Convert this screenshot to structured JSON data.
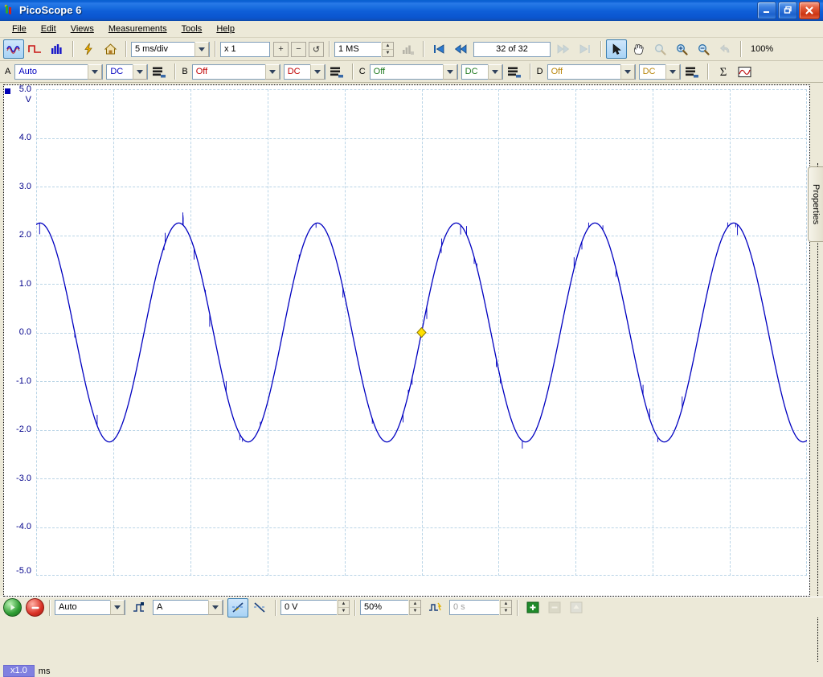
{
  "window": {
    "title": "PicoScope 6",
    "app_icon": "picoscope-logo-icon",
    "minimize_label": "_",
    "restore_label": "❐",
    "close_label": "✕"
  },
  "menubar": {
    "items": [
      {
        "label": "File",
        "accel": "F"
      },
      {
        "label": "Edit",
        "accel": "E"
      },
      {
        "label": "Views",
        "accel": "V"
      },
      {
        "label": "Measurements",
        "accel": "M"
      },
      {
        "label": "Tools",
        "accel": "T"
      },
      {
        "label": "Help",
        "accel": "H"
      }
    ]
  },
  "toolbar": {
    "scope_mode_icon": "sine-wave-icon",
    "spectrum_mode_icon": "square-pulse-icon",
    "bar_mode_icon": "bar-chart-icon",
    "trigger_icon": "lightning-bolt-icon",
    "home_icon": "home-icon",
    "timebase": {
      "value": "5 ms/div",
      "placeholder": "5 ms/div"
    },
    "zoom_factor": {
      "value": "x 1",
      "placeholder": "x 1"
    },
    "zoom_in_label": "+",
    "zoom_out_label": "−",
    "zoom_reset_label": "↺",
    "samples": {
      "value": "1 MS",
      "placeholder": "1 MS"
    },
    "capture_icon": "capture-chart-icon",
    "nav_first_icon": "first-buffer-icon",
    "nav_prev_icon": "previous-buffer-icon",
    "buffer_index": "32 of 32",
    "nav_next_icon": "next-buffer-icon",
    "nav_last_icon": "last-buffer-icon",
    "pointer_icon": "arrow-pointer-icon",
    "hand_icon": "hand-pan-icon",
    "zoom_window_icon": "zoom-window-icon",
    "zoom_plus_icon": "magnifier-plus-icon",
    "zoom_minus_icon": "magnifier-minus-icon",
    "undo_zoom_icon": "undo-zoom-icon",
    "zoom_level": "100%"
  },
  "channels": [
    {
      "name": "A",
      "range": "Auto",
      "coupling": "DC",
      "color": "#0000c0",
      "options_icon": "channel-options-icon",
      "enabled": true
    },
    {
      "name": "B",
      "range": "Off",
      "coupling": "DC",
      "color": "#c00000",
      "options_icon": "channel-options-icon",
      "enabled": false
    },
    {
      "name": "C",
      "range": "Off",
      "coupling": "DC",
      "color": "#1f7a1f",
      "options_icon": "channel-options-icon",
      "enabled": false
    },
    {
      "name": "D",
      "range": "Off",
      "coupling": "DC",
      "color": "#b8860b",
      "options_icon": "channel-options-icon",
      "enabled": false
    }
  ],
  "channel_extra": {
    "math_icon": "sigma-math-channel-icon",
    "reference_icon": "reference-waveform-icon"
  },
  "scope": {
    "properties_tab_label": "Properties",
    "channel_marker_name": "channel-a-marker",
    "trigger_marker_name": "trigger-point-marker",
    "time_scale_chip": "x1.0",
    "time_scale_unit": "ms"
  },
  "statusbar": {
    "run_icon": "run-capture-icon",
    "stop_icon": "stop-capture-icon",
    "trigger_mode": "Auto",
    "trigger_type_icon": "trigger-edge-icon",
    "trigger_source": "A",
    "rising_edge_icon": "rising-edge-icon",
    "falling_edge_icon": "falling-edge-icon",
    "trigger_level": "0 V",
    "pretrigger_percent": "50%",
    "advanced_trigger_icon": "advanced-trigger-icon",
    "post_trigger_delay": "0 s",
    "add_measurement_icon": "add-measurement-icon",
    "remove_measurement_icon": "remove-measurement-icon",
    "measurement_panel_icon": "measurement-panel-icon"
  },
  "chart_data": {
    "type": "line",
    "title": "",
    "xlabel": "ms",
    "ylabel": "V",
    "xlim": [
      -25.0,
      25.0
    ],
    "ylim": [
      -5.0,
      5.0
    ],
    "x_ticks": [
      "-25.0",
      "-20.0",
      "-15.0",
      "-10.0",
      "-5.0",
      "0.0",
      "5.0",
      "10.0",
      "15.0",
      "20.0",
      "25.0"
    ],
    "y_ticks": [
      "5.0",
      "4.0",
      "3.0",
      "2.0",
      "1.0",
      "0.0",
      "-1.0",
      "-2.0",
      "-3.0",
      "-4.0",
      "-5.0"
    ],
    "x_unit": "ms",
    "y_unit": "V",
    "grid": true,
    "grid_divisions_x": 10,
    "grid_divisions_y": 10,
    "timebase_per_div": "5 ms/div",
    "legend": [],
    "series": [
      {
        "name": "A",
        "color": "#0000c0",
        "waveform": "sine",
        "amplitude_v": 2.25,
        "offset_v": 0.0,
        "period_ms": 9.0,
        "frequency_hz": 111,
        "phase_deg": 0,
        "noise_spikes": true
      }
    ],
    "markers": [
      {
        "name": "trigger",
        "x": 0.0,
        "y": 0.0,
        "shape": "diamond",
        "color": "#ffe000"
      }
    ]
  }
}
